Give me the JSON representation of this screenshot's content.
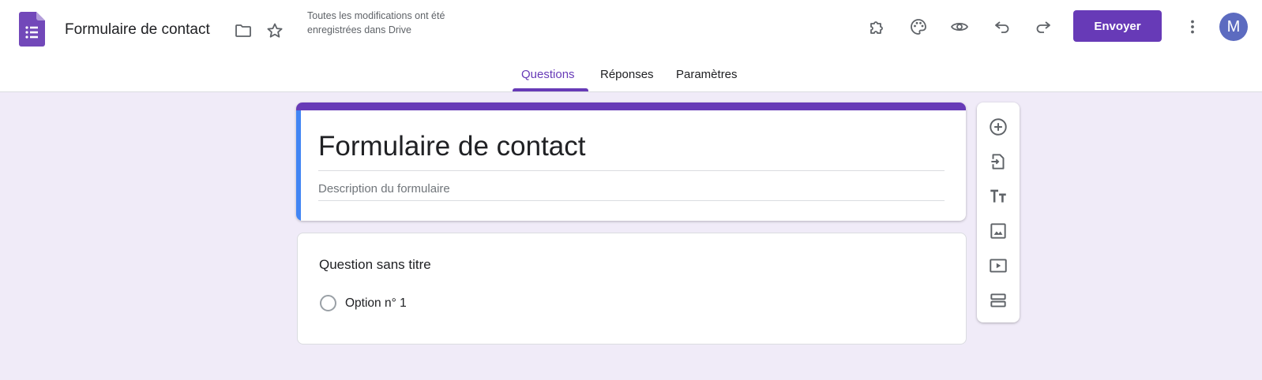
{
  "header": {
    "app_icon": "google-forms-icon",
    "doc_title": "Formulaire de contact",
    "save_status": "Toutes les modifications ont été enregistrées dans Drive",
    "icons": [
      "folder-icon",
      "star-icon",
      "addon-puzzle-icon",
      "palette-icon",
      "preview-eye-icon",
      "undo-icon",
      "redo-icon",
      "more-vert-icon"
    ],
    "send_label": "Envoyer",
    "avatar_initial": "M"
  },
  "tabs": [
    {
      "label": "Questions",
      "active": true
    },
    {
      "label": "Réponses",
      "active": false
    },
    {
      "label": "Paramètres",
      "active": false
    }
  ],
  "form": {
    "title": "Formulaire de contact",
    "description_placeholder": "Description du formulaire"
  },
  "question": {
    "title": "Question sans titre",
    "options": [
      "Option n° 1"
    ]
  },
  "toolbar": {
    "icons": [
      "add-question-icon",
      "import-questions-icon",
      "add-title-icon",
      "add-image-icon",
      "add-video-icon",
      "add-section-icon"
    ]
  },
  "colors": {
    "accent": "#673ab7",
    "background": "#f0ebf8",
    "title_card_side": "#4285f4",
    "avatar": "#5c6bc0"
  }
}
